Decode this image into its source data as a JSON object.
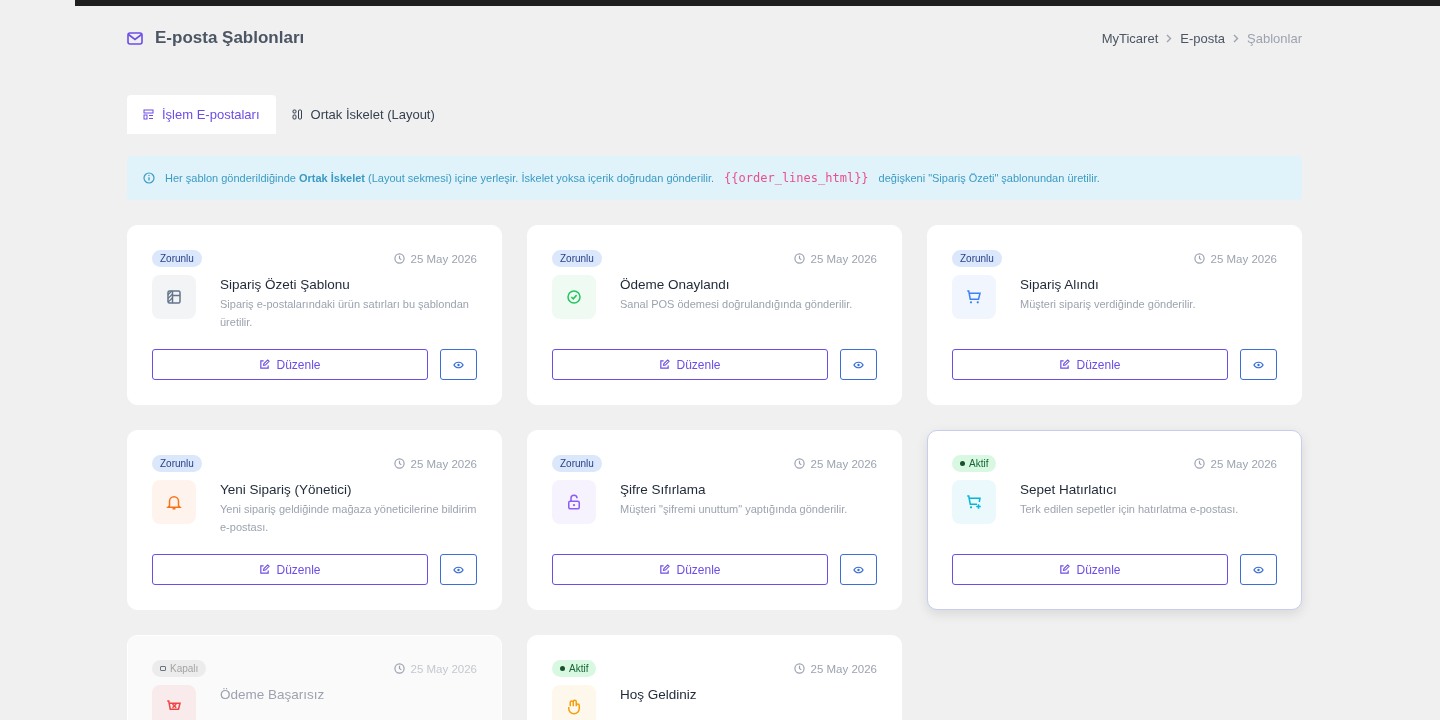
{
  "header": {
    "title": "E-posta Şablonları",
    "breadcrumb": [
      {
        "label": "MyTicaret",
        "current": false
      },
      {
        "label": "E-posta",
        "current": false
      },
      {
        "label": "Şablonlar",
        "current": true
      }
    ]
  },
  "tabs": [
    {
      "label": "İşlem E-postaları",
      "selected": true
    },
    {
      "label": "Ortak İskelet (Layout)",
      "selected": false
    }
  ],
  "info": {
    "text_before": "Her şablon gönderildiğinde **Ortak İskelet** (Layout sekmesi) içine yerleşir. İskelet yoksa içerik doğrudan gönderilir.",
    "code": "{{order_lines_html}}",
    "text_after": "değişkeni \"Sipariş Özeti\" şablonundan üretilir."
  },
  "cards": [
    {
      "kind": "required",
      "badge": "Zorunlu",
      "date": "25 May 2026",
      "title": "Sipariş Özeti Şablonu",
      "description": "Sipariş e-postalarındaki ürün satırları bu şablondan üretilir.",
      "color": "#64748b",
      "edit_label": "Düzenle",
      "selected": false
    },
    {
      "kind": "required",
      "badge": "Zorunlu",
      "date": "25 May 2026",
      "title": "Ödeme Onaylandı",
      "description": "Sanal POS ödemesi doğrulandığında gönderilir.",
      "color": "#22c55e",
      "edit_label": "Düzenle",
      "selected": false
    },
    {
      "kind": "required",
      "badge": "Zorunlu",
      "date": "25 May 2026",
      "title": "Sipariş Alındı",
      "description": "Müşteri sipariş verdiğinde gönderilir.",
      "color": "#3b82f6",
      "edit_label": "Düzenle",
      "selected": false
    },
    {
      "kind": "required",
      "badge": "Zorunlu",
      "date": "25 May 2026",
      "title": "Yeni Sipariş (Yönetici)",
      "description": "Yeni sipariş geldiğinde mağaza yöneticilerine bildirim e-postası.",
      "color": "#f97316",
      "edit_label": "Düzenle",
      "selected": false
    },
    {
      "kind": "required",
      "badge": "Zorunlu",
      "date": "25 May 2026",
      "title": "Şifre Sıfırlama",
      "description": "Müşteri \"şifremi unuttum\" yaptığında gönderilir.",
      "color": "#8b5cf6",
      "edit_label": "Düzenle",
      "selected": false
    },
    {
      "kind": "active",
      "badge": "Aktif",
      "date": "25 May 2026",
      "title": "Sepet Hatırlatıcı",
      "description": "Terk edilen sepetler için hatırlatma e-postası.",
      "color": "#06b6d4",
      "edit_label": "Düzenle",
      "selected": true
    },
    {
      "kind": "off",
      "badge": "Kapalı",
      "date": "25 May 2026",
      "title": "Ödeme Başarısız",
      "color": "#ef4444",
      "selected": false
    },
    {
      "kind": "active",
      "badge": "Aktif",
      "date": "25 May 2026",
      "title": "Hoş Geldiniz",
      "color": "#f59e0b",
      "selected": false
    }
  ]
}
